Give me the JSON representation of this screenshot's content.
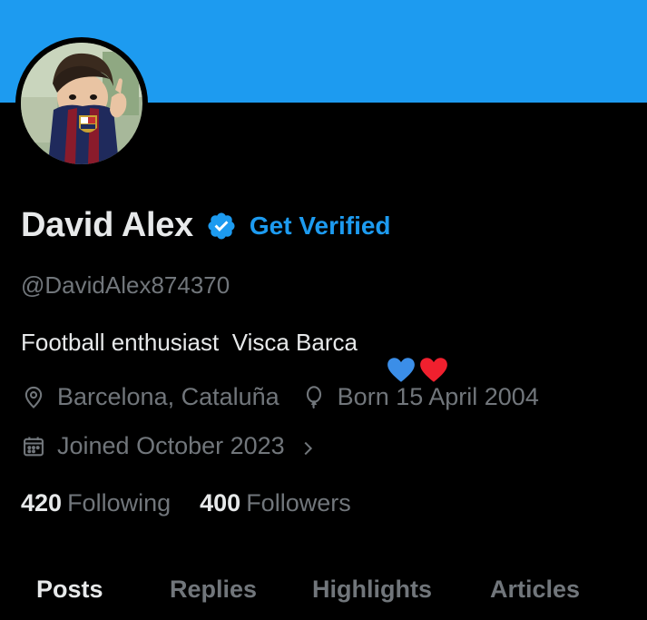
{
  "profile": {
    "name": "David Alex",
    "get_verified_label": "Get Verified",
    "handle": "@DavidAlex874370",
    "bio": "Football enthusiast  Visca Barca",
    "location": "Barcelona, Cataluña",
    "birthday": "Born 15 April 2004",
    "joined": "Joined October 2023",
    "following_count": "420",
    "following_label": "Following",
    "followers_count": "400",
    "followers_label": "Followers"
  },
  "tabs": [
    {
      "label": "Posts",
      "active": true
    },
    {
      "label": "Replies",
      "active": false
    },
    {
      "label": "Highlights",
      "active": false
    },
    {
      "label": "Articles",
      "active": false
    }
  ],
  "colors": {
    "banner": "#1d9bf0",
    "accent": "#1d9bf0",
    "background": "#000000",
    "primary_text": "#e7e9ea",
    "secondary_text": "#71767b"
  },
  "icons": {
    "verified": "verified-badge-icon",
    "location": "location-pin-icon",
    "birthday": "balloon-icon",
    "joined": "calendar-icon",
    "chevron": "chevron-right-icon",
    "bio_emojis": [
      "blue-heart-icon",
      "red-heart-icon"
    ]
  }
}
